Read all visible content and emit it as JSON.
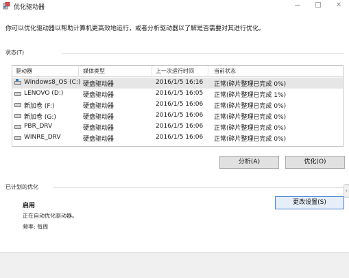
{
  "window": {
    "title": "优化驱动器"
  },
  "intro_text": "你可以优化驱动器以帮助计算机更高效地运行，或者分析驱动器以了解是否需要对其进行优化。",
  "status_section": {
    "label": "状态(T)",
    "columns": [
      "驱动器",
      "媒体类型",
      "上一次运行时间",
      "当前状态"
    ],
    "rows": [
      {
        "drive": "Windows8_OS (C:)",
        "media": "硬盘驱动器",
        "last_run": "2016/1/5 16:16",
        "status": "正常(碎片整理已完成 0%)"
      },
      {
        "drive": "LENOVO (D:)",
        "media": "硬盘驱动器",
        "last_run": "2016/1/5 16:05",
        "status": "正常(碎片整理已完成 1%)"
      },
      {
        "drive": "新加卷 (F:)",
        "media": "硬盘驱动器",
        "last_run": "2016/1/5 16:06",
        "status": "正常(碎片整理已完成 0%)"
      },
      {
        "drive": "新加卷 (G:)",
        "media": "硬盘驱动器",
        "last_run": "2016/1/5 16:06",
        "status": "正常(碎片整理已完成 0%)"
      },
      {
        "drive": "PBR_DRV",
        "media": "硬盘驱动器",
        "last_run": "2016/1/5 16:06",
        "status": "正常(碎片整理已完成 0%)"
      },
      {
        "drive": "WINRE_DRV",
        "media": "硬盘驱动器",
        "last_run": "2016/1/5 16:06",
        "status": "正常(碎片整理已完成 0%)"
      }
    ]
  },
  "buttons": {
    "analyze": "分析(A)",
    "optimize": "优化(O)",
    "change_settings": "更改设置(S)"
  },
  "scheduled_section": {
    "label": "已计划的优化",
    "state": "启用",
    "line1": "正在自动优化驱动器。",
    "line2": "频率: 每周"
  },
  "icons": {
    "app": "defrag-icon",
    "drive_system": "windows-drive-icon",
    "drive": "hard-drive-icon"
  },
  "colors": {
    "selected_row": "#e6e6e6",
    "focus_border": "#3c7fd6"
  }
}
